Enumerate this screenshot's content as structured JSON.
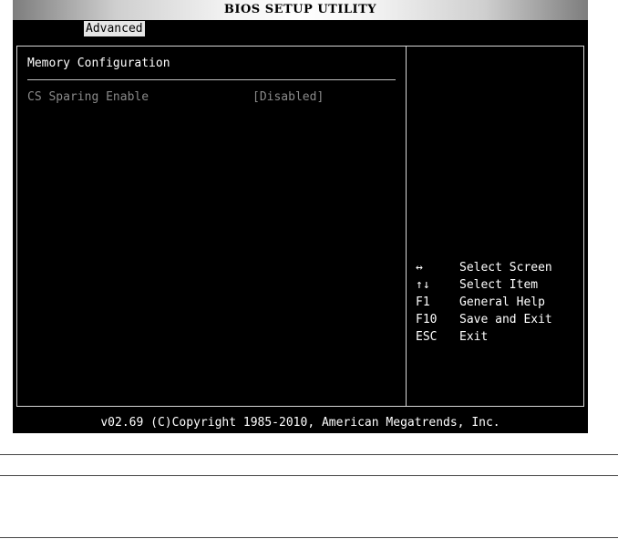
{
  "title": "BIOS SETUP UTILITY",
  "menu": {
    "active_tab": "Advanced"
  },
  "section": {
    "title": "Memory Configuration",
    "items": [
      {
        "label": "CS Sparing Enable",
        "value": "[Disabled]"
      }
    ]
  },
  "help": [
    {
      "key": "↔",
      "desc": "Select Screen"
    },
    {
      "key": "↑↓",
      "desc": "Select Item"
    },
    {
      "key": "F1",
      "desc": "General Help"
    },
    {
      "key": "F10",
      "desc": "Save and Exit"
    },
    {
      "key": "ESC",
      "desc": "Exit"
    }
  ],
  "footer": "v02.69 (C)Copyright 1985-2010, American Megatrends, Inc.",
  "colors": {
    "background": "#000000",
    "text": "#ffffff",
    "disabled_text": "#8a8a8a",
    "highlight": "#e6e6e6"
  }
}
